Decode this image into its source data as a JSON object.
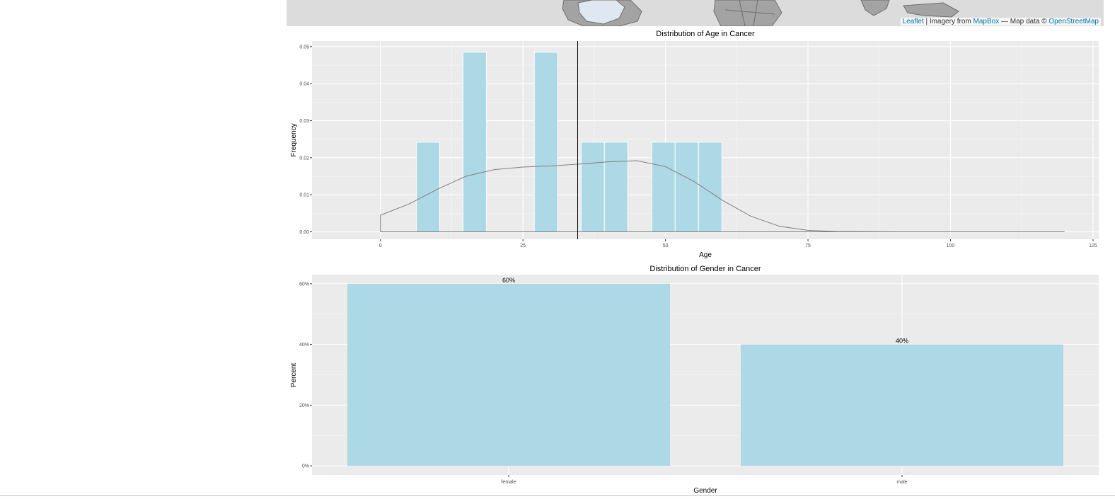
{
  "map": {
    "attribution": {
      "leaflet_link": "Leaflet",
      "separator": " | Imagery from ",
      "mapbox_link": "MapBox",
      "middle": " — Map data © ",
      "osm_link": "OpenStreetMap"
    },
    "colors": {
      "ocean": "#dcdcdc",
      "land": "#a3a3a3",
      "highlight": "#dfe8f0",
      "border": "#6e6e6e"
    }
  },
  "chart_data": [
    {
      "type": "bar",
      "title": "Distribution of Age in Cancer",
      "xlabel": "Age",
      "ylabel": "Frequency",
      "xlim": [
        -12,
        126
      ],
      "ylim": [
        -0.002,
        0.0515
      ],
      "x_ticks": [
        0,
        25,
        50,
        75,
        100,
        125
      ],
      "x_tick_labels": [
        "0",
        "25",
        "50",
        "75",
        "100",
        "125"
      ],
      "y_ticks": [
        0,
        0.01,
        0.02,
        0.03,
        0.04,
        0.05
      ],
      "y_tick_labels": [
        "0.00",
        "0.01",
        "0.02",
        "0.03",
        "0.04",
        "0.05"
      ],
      "bins": [
        {
          "start": 6.3,
          "end": 10.4,
          "value": 0.0242
        },
        {
          "start": 14.5,
          "end": 18.6,
          "value": 0.0485
        },
        {
          "start": 27.0,
          "end": 31.1,
          "value": 0.0485
        },
        {
          "start": 35.2,
          "end": 39.3,
          "value": 0.0242
        },
        {
          "start": 39.3,
          "end": 43.4,
          "value": 0.0242
        },
        {
          "start": 47.6,
          "end": 51.7,
          "value": 0.0242
        },
        {
          "start": 51.7,
          "end": 55.8,
          "value": 0.0242
        },
        {
          "start": 55.8,
          "end": 59.9,
          "value": 0.0242
        }
      ],
      "density_curve": {
        "x": [
          0,
          5,
          10,
          15,
          20,
          25,
          30,
          35,
          40,
          45,
          50,
          55,
          60,
          65,
          70,
          75,
          80,
          90,
          100,
          110,
          120
        ],
        "y": [
          0.0045,
          0.0075,
          0.0115,
          0.015,
          0.0168,
          0.0175,
          0.0178,
          0.0183,
          0.0189,
          0.0192,
          0.0176,
          0.0136,
          0.0085,
          0.0042,
          0.0015,
          0.0004,
          0.0001,
          0.0,
          0.0,
          0.0,
          0.0
        ]
      },
      "mean_line_x": 34.6,
      "grid": true,
      "colors": {
        "bar": "#add8e6",
        "panel": "#ebebeb",
        "curve": "#7f7f7f",
        "mean_line": "#000000"
      }
    },
    {
      "type": "bar",
      "title": "Distribution of Gender in Cancer",
      "xlabel": "Gender",
      "ylabel": "Percent",
      "categories": [
        "female",
        "male"
      ],
      "values": [
        0.6,
        0.4
      ],
      "data_labels": [
        "60%",
        "40%"
      ],
      "ylim": [
        -0.03,
        0.63
      ],
      "y_ticks": [
        0,
        0.2,
        0.4,
        0.6
      ],
      "y_tick_labels": [
        "0%",
        "20%",
        "40%",
        "60%"
      ],
      "grid": true,
      "colors": {
        "bar": "#add8e6",
        "panel": "#ebebeb"
      }
    }
  ]
}
